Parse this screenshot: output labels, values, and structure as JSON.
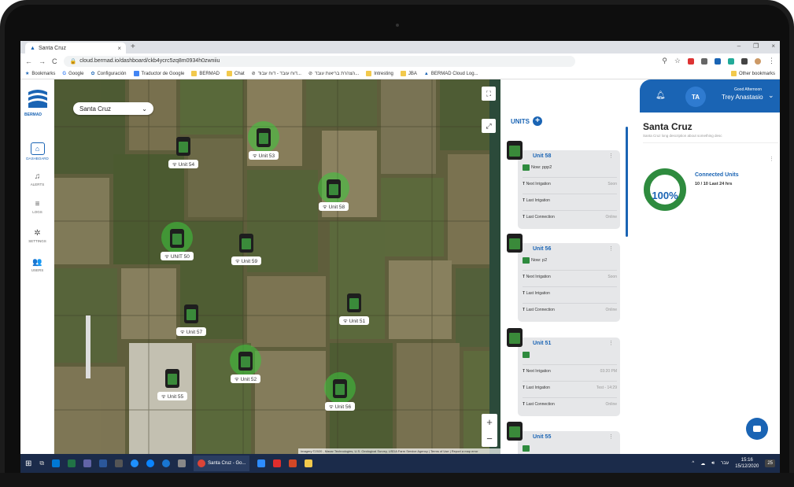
{
  "browser": {
    "tab_title": "Santa Cruz",
    "url": "cloud.bermad.io/dashboard/ckb4ycrc5zq8m0934h0zwniiu",
    "bookmarks": [
      "Bookmarks",
      "Google",
      "Configuración",
      "Traductor de Google",
      "BERMAD",
      "Chat",
      "דוח עובד - דוח עבוד...",
      "הצהרת בריאות עובד...",
      "Intresting",
      "JBA",
      "BERMAD Cloud Log..."
    ],
    "other_bookmarks": "Other bookmarks"
  },
  "sidebar": {
    "logo_text": "BERMAD",
    "items": [
      {
        "label": "DASHBOARD",
        "icon": "home-icon"
      },
      {
        "label": "ALERTS",
        "icon": "bell-icon"
      },
      {
        "label": "LOGS",
        "icon": "list-icon"
      },
      {
        "label": "SETTINGS",
        "icon": "gear-icon"
      },
      {
        "label": "USERS",
        "icon": "users-icon"
      }
    ]
  },
  "map": {
    "selected_site": "Santa Cruz",
    "attribution": "Imagery ©2020 , Maxar Technologies, U.S. Geological Survey, USDA Farm Service Agency | Terms of Use | Report a map error",
    "zoom_in": "+",
    "zoom_out": "−",
    "units": [
      {
        "label": "Unit 54",
        "active": false
      },
      {
        "label": "Unit 53",
        "active": true
      },
      {
        "label": "Unit 58",
        "active": true
      },
      {
        "label": "UNIT 50",
        "active": true
      },
      {
        "label": "Unit 59",
        "active": false
      },
      {
        "label": "Unit 51",
        "active": false
      },
      {
        "label": "Unit 57",
        "active": false
      },
      {
        "label": "Unit 52",
        "active": true
      },
      {
        "label": "Unit 55",
        "active": false
      },
      {
        "label": "Unit 56",
        "active": true
      }
    ]
  },
  "units_panel": {
    "heading": "UNITS",
    "cards": [
      {
        "title": "Unit 58",
        "now": "Now: ppp2",
        "rows": [
          {
            "label": "Next Irrigation",
            "value": "Soon"
          },
          {
            "label": "Last Irrigation",
            "value": ""
          },
          {
            "label": "Last Connection",
            "value": "Online"
          }
        ]
      },
      {
        "title": "Unit 56",
        "now": "Now: p2",
        "rows": [
          {
            "label": "Next Irrigation",
            "value": "Soon"
          },
          {
            "label": "Last Irrigation",
            "value": ""
          },
          {
            "label": "Last Connection",
            "value": "Online"
          }
        ]
      },
      {
        "title": "Unit 51",
        "now": "",
        "rows": [
          {
            "label": "Next Irrigation",
            "value": "03:20 PM"
          },
          {
            "label": "Last Irrigation",
            "value": "Test - 14:29"
          },
          {
            "label": "Last Connection",
            "value": "Online"
          }
        ]
      },
      {
        "title": "Unit 55",
        "now": "",
        "rows": []
      }
    ]
  },
  "right_panel": {
    "avatar": "TA",
    "greeting": "Good Afternoon",
    "user_name": "Trey Anastasio",
    "site_title": "Santa Cruz",
    "site_desc": "Santa Cruz long description about something desc",
    "connected_title": "Connected Units",
    "connected_sub": "10 / 10 Last 24 hrs",
    "connected_pct": "100%"
  },
  "taskbar": {
    "app_label": "Santa Cruz - Go...",
    "lang": "עבר",
    "time": "15:16",
    "date": "15/12/2020",
    "notif_count": "25"
  },
  "colors": {
    "brand": "#1a64b4",
    "online": "#2e8b3e"
  }
}
